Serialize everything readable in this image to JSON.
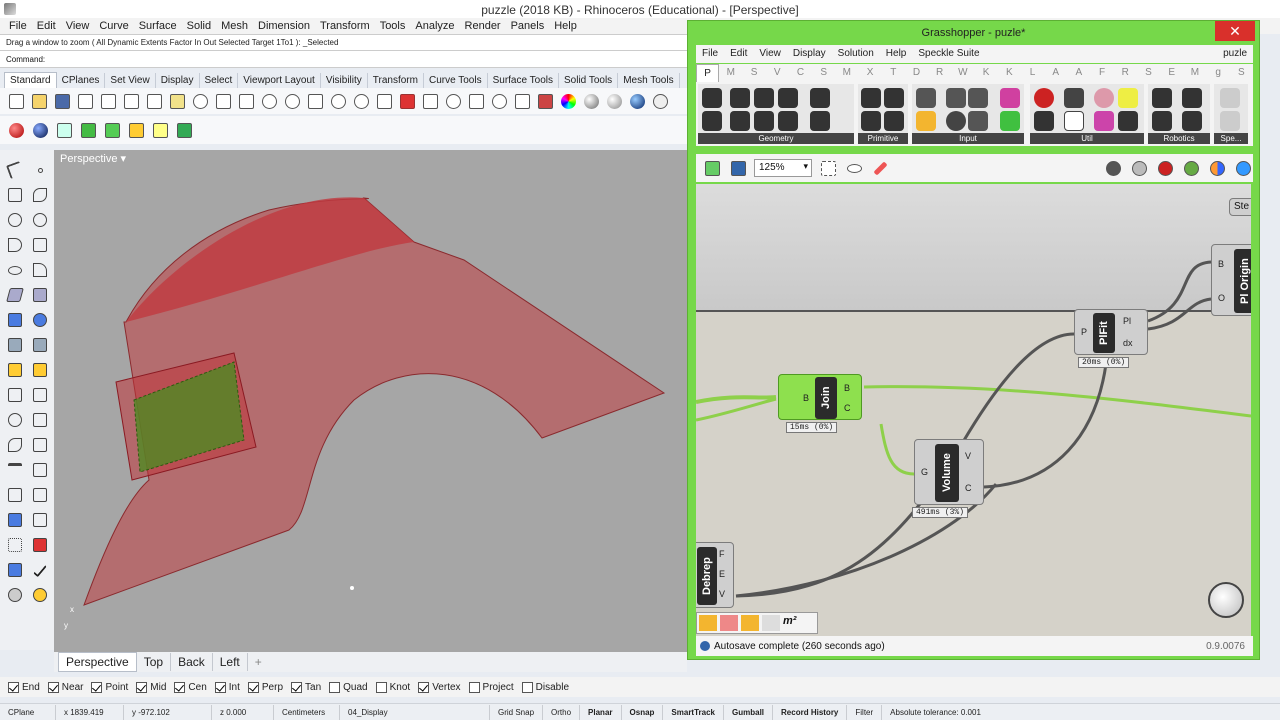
{
  "window": {
    "title": "puzzle (2018 KB) - Rhinoceros (Educational) - [Perspective]"
  },
  "menu": [
    "File",
    "Edit",
    "View",
    "Curve",
    "Surface",
    "Solid",
    "Mesh",
    "Dimension",
    "Transform",
    "Tools",
    "Analyze",
    "Render",
    "Panels",
    "Help"
  ],
  "command": {
    "history": "Drag a window to zoom ( All  Dynamic  Extents  Factor  In  Out  Selected  Target  1To1 ): _Selected",
    "prompt": "Command:"
  },
  "tabs": [
    "Standard",
    "CPlanes",
    "Set View",
    "Display",
    "Select",
    "Viewport Layout",
    "Visibility",
    "Transform",
    "Curve Tools",
    "Surface Tools",
    "Solid Tools",
    "Mesh Tools"
  ],
  "viewport": {
    "name": "Perspective",
    "tabs": [
      "Perspective",
      "Top",
      "Back",
      "Left"
    ],
    "add_tab": "+"
  },
  "osnaps": [
    {
      "label": "End",
      "checked": true
    },
    {
      "label": "Near",
      "checked": true
    },
    {
      "label": "Point",
      "checked": true
    },
    {
      "label": "Mid",
      "checked": true
    },
    {
      "label": "Cen",
      "checked": true
    },
    {
      "label": "Int",
      "checked": true
    },
    {
      "label": "Perp",
      "checked": true
    },
    {
      "label": "Tan",
      "checked": true
    },
    {
      "label": "Quad",
      "checked": false
    },
    {
      "label": "Knot",
      "checked": false
    },
    {
      "label": "Vertex",
      "checked": true
    },
    {
      "label": "Project",
      "checked": false
    },
    {
      "label": "Disable",
      "checked": false
    }
  ],
  "status": {
    "cplane": "CPlane",
    "x": "x 1839.419",
    "y": "y -972.102",
    "z": "z 0.000",
    "units": "Centimeters",
    "layer": "04_Display",
    "items": [
      "Grid Snap",
      "Ortho",
      "Planar",
      "Osnap",
      "SmartTrack",
      "Gumball",
      "Record History",
      "Filter"
    ],
    "tolerance": "Absolute tolerance: 0.001"
  },
  "gh": {
    "title": "Grasshopper - puzle*",
    "menu": [
      "File",
      "Edit",
      "View",
      "Display",
      "Solution",
      "Help",
      "Speckle Suite"
    ],
    "doc_name": "puzle",
    "tabs": [
      "P",
      "M",
      "S",
      "V",
      "C",
      "S",
      "M",
      "X",
      "T",
      "D",
      "R",
      "W",
      "K",
      "K",
      "L",
      "A",
      "A",
      "F",
      "R",
      "S",
      "E",
      "M",
      "g",
      "S"
    ],
    "groups": [
      "Geometry",
      "Primitive",
      "Input",
      "Util",
      "Robotics",
      "Spe..."
    ],
    "zoom": "125%",
    "components": {
      "join": {
        "nick": "Join",
        "in": "B",
        "out1": "B",
        "out2": "C",
        "timer": "15ms (0%)"
      },
      "volume": {
        "nick": "Volume",
        "in": "G",
        "out1": "V",
        "out2": "C",
        "timer": "491ms (3%)"
      },
      "plfit": {
        "nick": "PlFit",
        "in": "P",
        "out1": "Pl",
        "out2": "dx",
        "timer": "20ms (0%)"
      },
      "plorigin": {
        "nick": "Pl Origin",
        "in1": "B",
        "in2": "O"
      },
      "debrep": {
        "nick": "Debrep",
        "out1": "F",
        "out2": "E",
        "out3": "V"
      },
      "partial": {
        "nick": "Ste"
      }
    },
    "status": "Autosave complete (260 seconds ago)",
    "version": "0.9.0076"
  }
}
